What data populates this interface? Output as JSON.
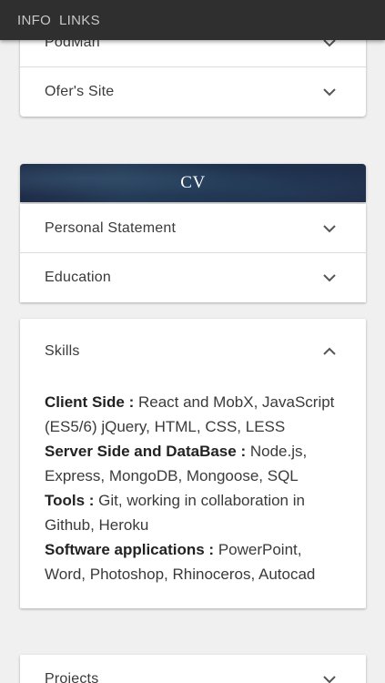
{
  "topbar": {
    "nav": [
      "INFO",
      "LINKS"
    ]
  },
  "links_section": {
    "items": [
      {
        "label": "PodMan"
      },
      {
        "label": "Ofer's Site"
      }
    ]
  },
  "cv_section": {
    "title": "CV",
    "items": [
      {
        "label": "Personal Statement"
      },
      {
        "label": "Education"
      }
    ],
    "skills": {
      "label": "Skills",
      "entries": [
        {
          "heading": "Client Side :",
          "text": " React and MobX, JavaScript (ES5/6) jQuery, HTML, CSS, LESS"
        },
        {
          "heading": "Server Side and DataBase :",
          "text": " Node.js, Express, MongoDB, Mongoose, SQL"
        },
        {
          "heading": "Tools :",
          "text": " Git, working in collaboration in Github, Heroku"
        },
        {
          "heading": "Software applications :",
          "text": " PowerPoint, Word, Photoshop, Rhinoceros, Autocad"
        }
      ]
    },
    "projects": {
      "label": "Projects"
    }
  },
  "colors": {
    "topbar_bg": "#2f2f2f",
    "page_bg": "#f0f0f0",
    "card_bg": "#ffffff",
    "cv_header_bg": "#1f2d48"
  },
  "icons": {
    "collapsed": "chevron-down-icon",
    "expanded": "chevron-up-icon"
  }
}
